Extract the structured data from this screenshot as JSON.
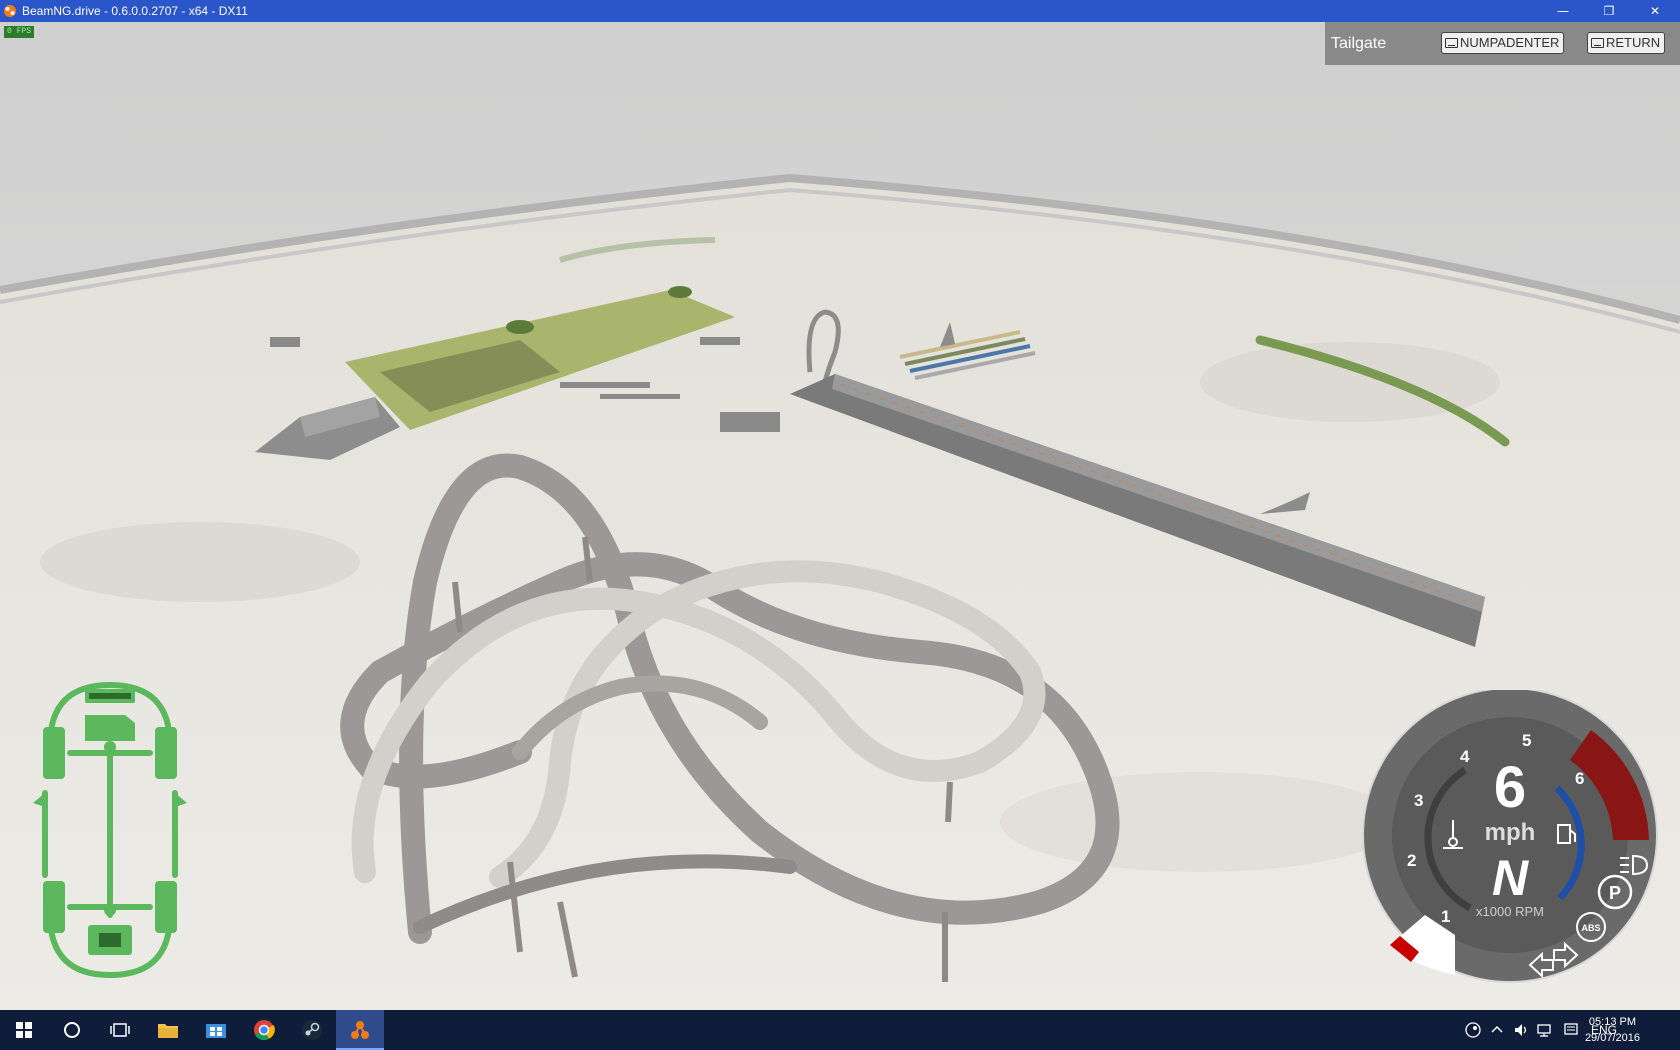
{
  "window": {
    "title": "BeamNG.drive - 0.6.0.0.2707 - x64 - DX11",
    "minimize_glyph": "—",
    "restore_glyph": "❐",
    "close_glyph": "✕"
  },
  "hud": {
    "fps_label": "0 FPS",
    "action_label": "Tailgate",
    "buttons": [
      {
        "key_label": "NUMPADENTER"
      },
      {
        "key_label": "RETURN"
      }
    ]
  },
  "dashboard": {
    "speed": "6",
    "speed_unit": "mph",
    "gear": "N",
    "rpm_unit": "x1000 RPM",
    "rpm_ticks": [
      "1",
      "2",
      "3",
      "4",
      "5",
      "6"
    ],
    "parking_indicator": "P",
    "abs_indicator": "ABS",
    "colors": {
      "dial": "#5a5a5a",
      "redline": "#8a1515",
      "temp_arc": "#1e4fa8",
      "text": "#ffffff"
    }
  },
  "chassis": {
    "color": "#5cb85c"
  },
  "taskbar": {
    "apps": [
      "start-icon",
      "cortana-icon",
      "task-view-icon",
      "file-explorer-icon",
      "store-icon",
      "chrome-icon",
      "steam-icon",
      "beamng-icon"
    ],
    "tray": {
      "language": "ENG",
      "time": "05:13 PM",
      "date": "29/07/2016"
    }
  }
}
